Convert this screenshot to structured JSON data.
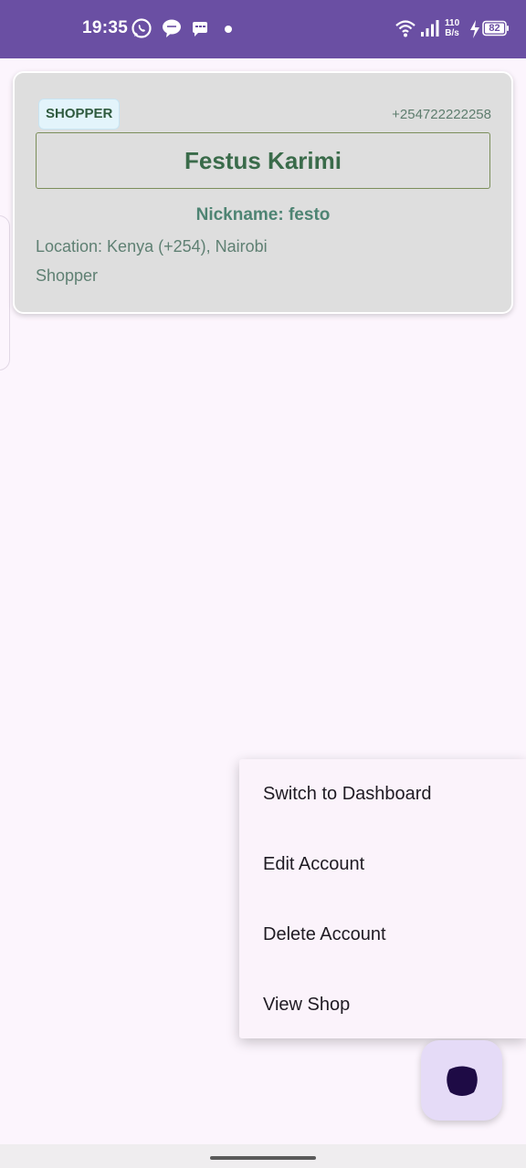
{
  "status_bar": {
    "time": "19:35",
    "network_speed_value": "110",
    "network_speed_unit": "B/s",
    "battery": "82",
    "icons": [
      "whatsapp-icon",
      "chat-bubble-icon",
      "message-icon",
      "dot-icon",
      "wifi-icon",
      "signal-icon",
      "charging-icon",
      "battery-icon"
    ]
  },
  "profile": {
    "role_badge": "SHOPPER",
    "phone": "+254722222258",
    "name": "Festus Karimi",
    "nickname": "Nickname: festo",
    "location": "Location: Kenya (+254), Nairobi",
    "role": "Shopper"
  },
  "menu": {
    "items": [
      {
        "label": "Switch to Dashboard"
      },
      {
        "label": "Edit Account"
      },
      {
        "label": "Delete Account"
      },
      {
        "label": "View Shop"
      }
    ]
  },
  "colors": {
    "status_bar": "#6A4FA3",
    "background": "#FCF5FD",
    "card": "#DEDEDE",
    "name_text": "#3A6B4A",
    "fab": "#E5DBF7",
    "fab_icon": "#1E0B45"
  },
  "fab": {
    "icon": "profile-blob-icon"
  }
}
